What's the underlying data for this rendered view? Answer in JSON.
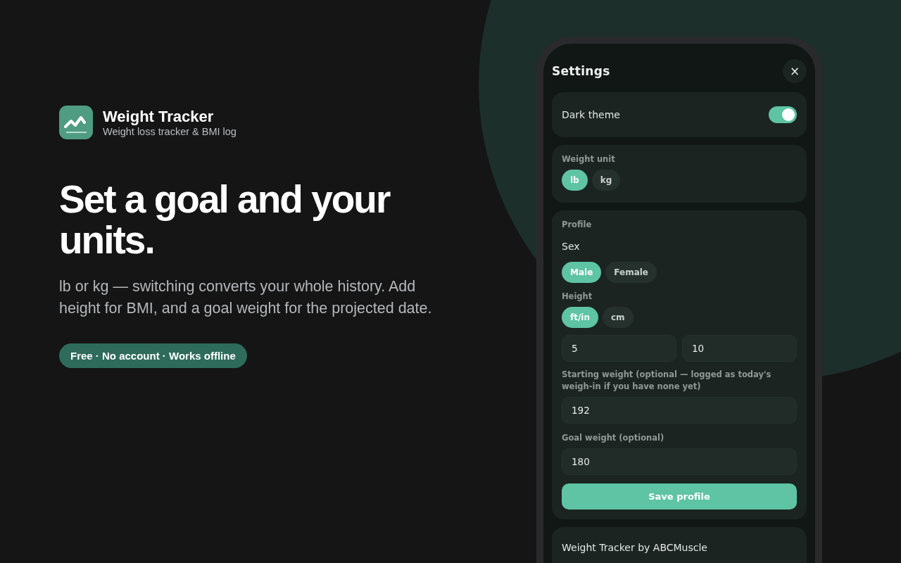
{
  "brand": {
    "name": "Weight Tracker",
    "tagline": "Weight loss tracker & BMI log"
  },
  "headline": "Set a goal and your units.",
  "description": "lb or kg — switching converts your whole history. Add height for BMI, and a goal weight for the projected date.",
  "pill": "Free · No account · Works offline",
  "settings": {
    "title": "Settings",
    "close": "×",
    "dark_theme": {
      "label": "Dark theme",
      "on": true
    },
    "weight_unit": {
      "label": "Weight unit",
      "options": [
        {
          "label": "lb",
          "selected": true
        },
        {
          "label": "kg",
          "selected": false
        }
      ]
    },
    "profile": {
      "label": "Profile",
      "sex_label": "Sex",
      "sex_options": [
        {
          "label": "Male",
          "selected": true
        },
        {
          "label": "Female",
          "selected": false
        }
      ],
      "height_label": "Height",
      "height_options": [
        {
          "label": "ft/in",
          "selected": true
        },
        {
          "label": "cm",
          "selected": false
        }
      ],
      "height_values": [
        "5",
        "10"
      ],
      "starting_label": "Starting weight (optional — logged as today's weigh-in if you have none yet)",
      "starting_value": "192",
      "goal_label": "Goal weight (optional)",
      "goal_value": "180",
      "save": "Save profile"
    },
    "footer": "Weight Tracker by ABCMuscle"
  }
}
